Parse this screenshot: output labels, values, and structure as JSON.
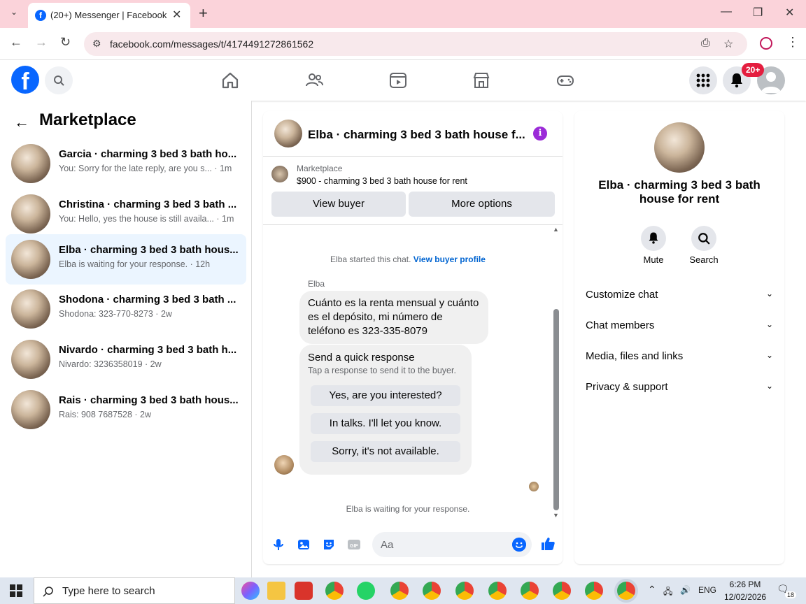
{
  "browser": {
    "tab_title": "(20+) Messenger | Facebook",
    "url": "facebook.com/messages/t/4174491272861562",
    "colors": {
      "tabbar": "#fbd3da"
    }
  },
  "fb": {
    "notification_badge": "20+",
    "brand_color": "#0866ff"
  },
  "left": {
    "heading": "Marketplace",
    "conversations": [
      {
        "name": "Garcia · charming 3 bed 3 bath ho...",
        "snippet": "You: Sorry for the late reply, are you s... · 1m"
      },
      {
        "name": "Christina · charming 3 bed 3 bath ...",
        "snippet": "You: Hello, yes the house is still availa... · 1m"
      },
      {
        "name": "Elba · charming 3 bed 3 bath hous...",
        "snippet": "Elba is waiting for your response. · 12h"
      },
      {
        "name": "Shodona · charming 3 bed 3 bath ...",
        "snippet": "Shodona: 323-770-8273 · 2w"
      },
      {
        "name": "Nivardo · charming 3 bed 3 bath h...",
        "snippet": "Nivardo: 3236358019 · 2w"
      },
      {
        "name": "Rais · charming 3 bed 3 bath hous...",
        "snippet": "Rais: 908 7687528 · 2w"
      }
    ]
  },
  "chat": {
    "title": "Elba · charming 3 bed 3 bath house f...",
    "marketplace_label": "Marketplace",
    "listing": "$900 - charming 3 bed 3 bath house for rent",
    "view_buyer": "View buyer",
    "more_options": "More options",
    "started_text": "Elba started this chat.",
    "view_buyer_profile": "View buyer profile",
    "sender": "Elba",
    "message": "Cuánto es la renta mensual y cuánto es el depósito, mi número de teléfono es 323-335-8079",
    "quick_title": "Send a quick response",
    "quick_sub": "Tap a response to send it to the buyer.",
    "quick_options": [
      "Yes, are you interested?",
      "In talks. I'll let you know.",
      "Sorry, it's not available."
    ],
    "waiting": "Elba is waiting for your response.",
    "input_placeholder": "Aa"
  },
  "right": {
    "title": "Elba · charming 3 bed 3 bath house for rent",
    "mute": "Mute",
    "search": "Search",
    "sections": [
      "Customize chat",
      "Chat members",
      "Media, files and links",
      "Privacy & support"
    ]
  },
  "taskbar": {
    "search_placeholder": "Type here to search",
    "language": "ENG",
    "time": "6:26 PM",
    "date": "12/02/2026",
    "notif_count": "18"
  }
}
